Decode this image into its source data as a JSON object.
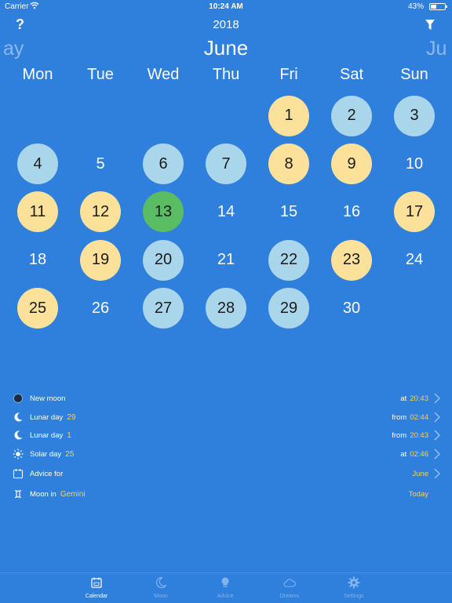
{
  "status_bar": {
    "carrier": "Carrier",
    "time": "10:24 AM",
    "battery": "43%",
    "battery_level": 0.43
  },
  "nav": {
    "help": "?",
    "year": "2018"
  },
  "month": {
    "prev": "ay",
    "current": "June",
    "next": "Ju"
  },
  "weekdays": [
    "Mon",
    "Tue",
    "Wed",
    "Thu",
    "Fri",
    "Sat",
    "Sun"
  ],
  "days": [
    {
      "num": "",
      "color": "none"
    },
    {
      "num": "",
      "color": "none"
    },
    {
      "num": "",
      "color": "none"
    },
    {
      "num": "",
      "color": "none"
    },
    {
      "num": "1",
      "color": "yellow"
    },
    {
      "num": "2",
      "color": "lightblue"
    },
    {
      "num": "3",
      "color": "lightblue"
    },
    {
      "num": "4",
      "color": "lightblue"
    },
    {
      "num": "5",
      "color": "none"
    },
    {
      "num": "6",
      "color": "lightblue"
    },
    {
      "num": "7",
      "color": "lightblue"
    },
    {
      "num": "8",
      "color": "yellow"
    },
    {
      "num": "9",
      "color": "yellow"
    },
    {
      "num": "10",
      "color": "none"
    },
    {
      "num": "11",
      "color": "yellow"
    },
    {
      "num": "12",
      "color": "yellow"
    },
    {
      "num": "13",
      "color": "green"
    },
    {
      "num": "14",
      "color": "none"
    },
    {
      "num": "15",
      "color": "none"
    },
    {
      "num": "16",
      "color": "none"
    },
    {
      "num": "17",
      "color": "yellow"
    },
    {
      "num": "18",
      "color": "none"
    },
    {
      "num": "19",
      "color": "yellow"
    },
    {
      "num": "20",
      "color": "lightblue"
    },
    {
      "num": "21",
      "color": "none"
    },
    {
      "num": "22",
      "color": "lightblue"
    },
    {
      "num": "23",
      "color": "yellow"
    },
    {
      "num": "24",
      "color": "none"
    },
    {
      "num": "25",
      "color": "yellow"
    },
    {
      "num": "26",
      "color": "none"
    },
    {
      "num": "27",
      "color": "lightblue"
    },
    {
      "num": "28",
      "color": "lightblue"
    },
    {
      "num": "29",
      "color": "lightblue"
    },
    {
      "num": "30",
      "color": "none"
    }
  ],
  "events": {
    "new_moon": {
      "label": "New moon",
      "prefix": "at",
      "value": "20:43"
    },
    "lunar_day_29": {
      "label": "Lunar day",
      "num": "29",
      "prefix": "from",
      "value": "02:44"
    },
    "lunar_day_1": {
      "label": "Lunar day",
      "num": "1",
      "prefix": "from",
      "value": "20:43"
    },
    "solar_day": {
      "label": "Solar day",
      "num": "25",
      "prefix": "at",
      "value": "02:46"
    },
    "advice": {
      "label": "Advice for",
      "value": "June"
    },
    "moon_in": {
      "label": "Moon in",
      "sign": "Gemini",
      "value": "Today"
    }
  },
  "tabs": [
    "Calendar",
    "Moon",
    "Advice",
    "Dreams",
    "Settings"
  ],
  "colors": {
    "background": "#2f7fdc",
    "accent_yellow": "#f6d060",
    "circle_yellow": "#fbe19a",
    "circle_blue": "#a9d6ea",
    "circle_green": "#5bbd63",
    "tab_inactive": "#82b3ec"
  }
}
